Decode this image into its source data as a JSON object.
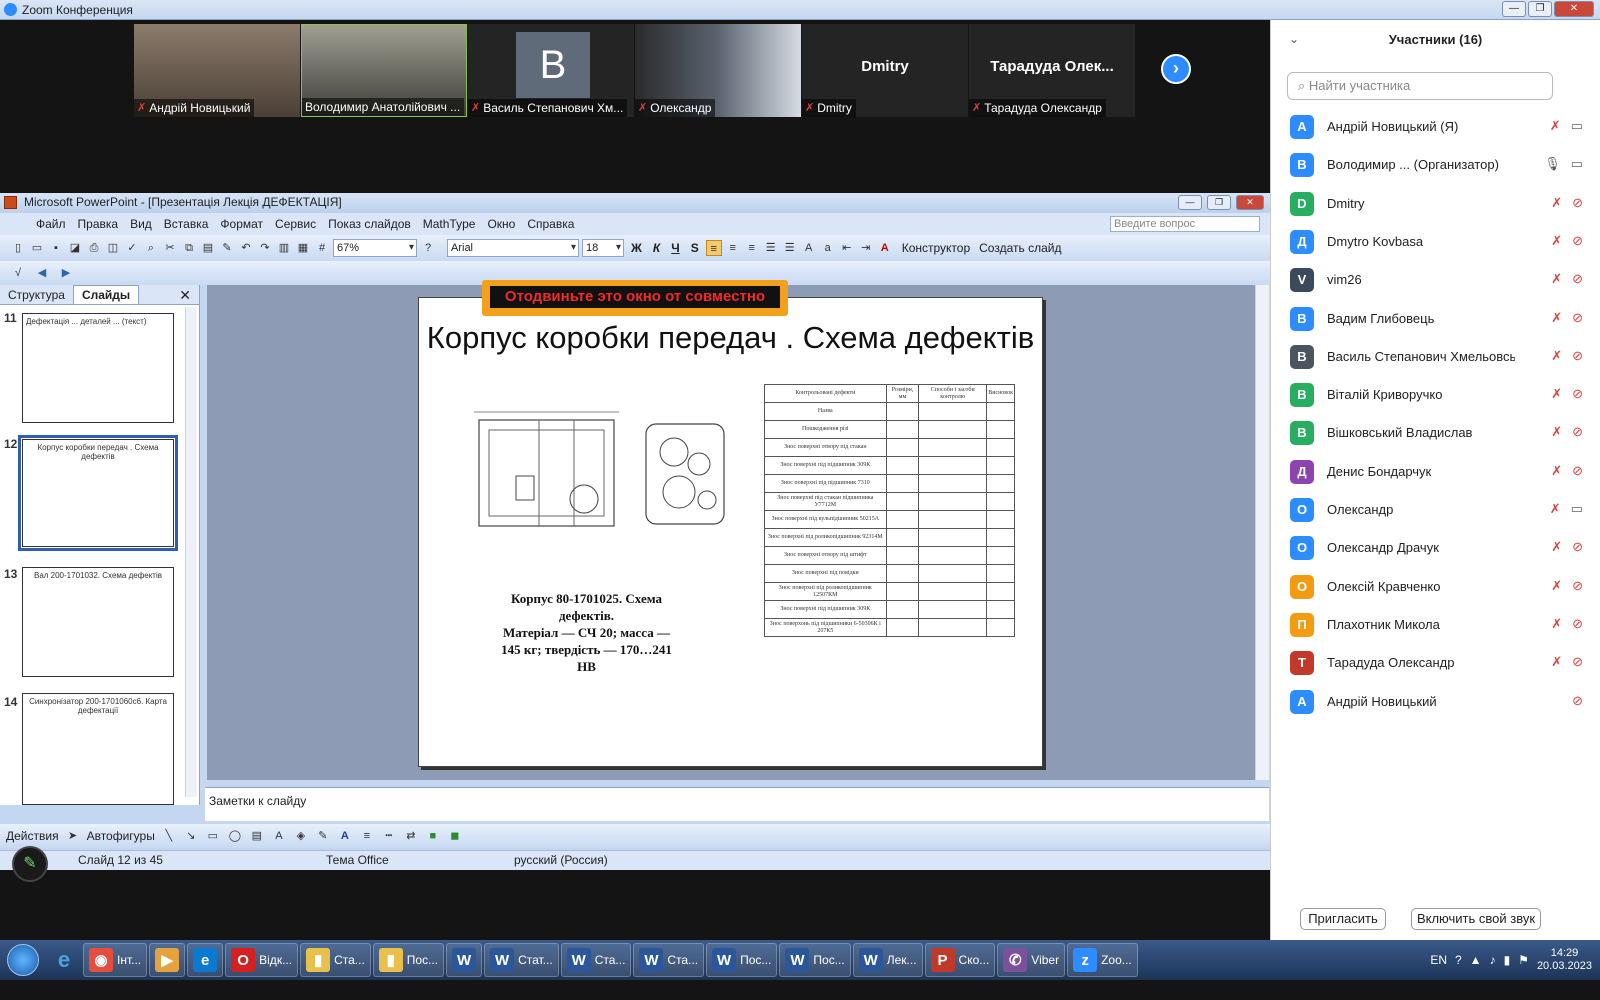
{
  "zoom": {
    "title": "Zoom Конференция"
  },
  "gallery": [
    {
      "name": "Андрій Новицький",
      "muted": true,
      "type": "video",
      "bg": "#6b5a4e"
    },
    {
      "name": "Володимир Анатолійович ...",
      "muted": false,
      "type": "video",
      "bg": "#7a7a70"
    },
    {
      "name": "Василь Степанович Хм...",
      "muted": true,
      "type": "avatar",
      "letter": "B"
    },
    {
      "name": "Олександр",
      "muted": true,
      "type": "video",
      "bg": "#5a6470"
    },
    {
      "name": "Dmitry",
      "muted": true,
      "type": "text",
      "big": "Dmitry"
    },
    {
      "name": "Тарадуда Олександр",
      "muted": true,
      "type": "text",
      "big": "Тарадуда  Олек..."
    }
  ],
  "ppt": {
    "title": "Microsoft PowerPoint - [Презентація  Лекція ДЕФЕКТАЦІЯ]",
    "menu": [
      "Файл",
      "Правка",
      "Вид",
      "Вставка",
      "Формат",
      "Сервис",
      "Показ слайдов",
      "MathType",
      "Окно",
      "Справка"
    ],
    "ask_placeholder": "Введите вопрос",
    "zoom": "67%",
    "font": "Arial",
    "size": "18",
    "fmt_bold": "Ж",
    "fmt_italic": "К",
    "fmt_underline": "Ч",
    "fmt_shadow": "S",
    "designer": "Конструктор",
    "new_slide": "Создать слайд",
    "tab_outline": "Структура",
    "tab_slides": "Слайды",
    "thumbs": [
      {
        "num": "11",
        "text": "Дефектація ... деталей ... (текст)"
      },
      {
        "num": "12",
        "text": "Корпус коробки передач . Схема дефектів"
      },
      {
        "num": "13",
        "text": "Вал 200-1701032. Схема дефектів"
      },
      {
        "num": "14",
        "text": "Синхронізатор 200-1701060с6. Карта дефектації"
      }
    ],
    "share_label": "Отодвиньте это окно от совместно",
    "slide_title": "Корпус коробки передач . Схема дефектів",
    "caption": [
      "Корпус 80-1701025. Схема",
      "дефектів.",
      "Матеріал — СЧ 20; масса —",
      "145 кг; твердість — 170…241",
      "НВ"
    ],
    "table_head": [
      "Контрольовані дефекти",
      "Розміри, мм",
      "Способи і засоби контролю",
      "Висновок"
    ],
    "table_rows": [
      "Назва",
      "1",
      "Пошкодження різі",
      "Знос поверхні отвору під стакан",
      "Знос поверхні під підшипник 309К",
      "Знос поверхні під підшипник 7310",
      "Знос поверхні під стакан підшипника У7712М",
      "Знос поверхні під кульпідшипник 50215А",
      "Знос поверхні під роликопідшипник 92314М",
      "Знос поверхні отвору під штифт",
      "Знос поверхні під повідки",
      "Знос поверхні під роликопідшипник 12507КМ",
      "Знос поверхні під підшипник 309К",
      "Знос поверхонь під підшипники 6-50306К і 207К5"
    ],
    "notes": "Заметки к слайду",
    "actions": "Действия",
    "autoshapes": "Автофигуры",
    "status_slide": "Слайд 12 из 45",
    "status_theme": "Тема Office",
    "status_lang": "русский (Россия)"
  },
  "participants": {
    "header": "Участники (16)",
    "search_placeholder": "Найти участника",
    "list": [
      {
        "letter": "A",
        "color": "#2d8cff",
        "name": "Андрій Новицький (Я)",
        "video": true
      },
      {
        "letter": "B",
        "color": "#2d8cff",
        "name": "Володимир ...  (Организатор)",
        "mic": "on",
        "video": true
      },
      {
        "letter": "D",
        "color": "#27ae60",
        "name": "Dmitry"
      },
      {
        "letter": "Д",
        "color": "#2d8cff",
        "name": "Dmytro Kovbasa"
      },
      {
        "letter": "V",
        "color": "#3a4a5c",
        "name": "vim26"
      },
      {
        "letter": "B",
        "color": "#2d8cff",
        "name": "Вадим Глибовець"
      },
      {
        "letter": "B",
        "color": "#4a5560",
        "name": "Василь Степанович Хмельовсь..."
      },
      {
        "letter": "B",
        "color": "#27ae60",
        "name": "Віталій Криворучко"
      },
      {
        "letter": "B",
        "color": "#27ae60",
        "name": "Вішковський Владислав"
      },
      {
        "letter": "Д",
        "color": "#8e44ad",
        "name": "Денис Бондарчук"
      },
      {
        "letter": "O",
        "color": "#2d8cff",
        "name": "Олександр",
        "video": true
      },
      {
        "letter": "O",
        "color": "#2d8cff",
        "name": "Олександр Драчук"
      },
      {
        "letter": "O",
        "color": "#f39c12",
        "name": "Олексій Кравченко"
      },
      {
        "letter": "П",
        "color": "#f39c12",
        "name": "Плахотник Микола"
      },
      {
        "letter": "T",
        "color": "#c0392b",
        "name": "Тарадуда Олександр"
      },
      {
        "letter": "A",
        "color": "#2d8cff",
        "name": "Андрій Новицький",
        "nomic": true
      }
    ],
    "invite": "Пригласить",
    "unmute": "Включить свой звук"
  },
  "taskbar": {
    "items": [
      {
        "label": "Інт...",
        "color": "#e74c3c",
        "icon": "chrome-icon",
        "glyph": "◉"
      },
      {
        "label": "",
        "color": "#e6a23c",
        "icon": "media-player-icon",
        "glyph": "▶"
      },
      {
        "label": "",
        "color": "#0b79d0",
        "icon": "edge-icon",
        "glyph": "e"
      },
      {
        "label": "Відк...",
        "color": "#d32020",
        "icon": "opera-icon",
        "glyph": "O"
      },
      {
        "label": "Ста...",
        "color": "#e8c04a",
        "icon": "folder-icon",
        "glyph": "▮"
      },
      {
        "label": "Пос...",
        "color": "#e8c04a",
        "icon": "folder-icon",
        "glyph": "▮"
      },
      {
        "label": "",
        "color": "#2b579a",
        "icon": "word-icon",
        "glyph": "W"
      },
      {
        "label": "Стат...",
        "color": "#2b579a",
        "icon": "word-icon",
        "glyph": "W"
      },
      {
        "label": "Ста...",
        "color": "#2b579a",
        "icon": "word-icon",
        "glyph": "W"
      },
      {
        "label": "Ста...",
        "color": "#2b579a",
        "icon": "word-icon",
        "glyph": "W"
      },
      {
        "label": "Пос...",
        "color": "#2b579a",
        "icon": "word-icon",
        "glyph": "W"
      },
      {
        "label": "Пос...",
        "color": "#2b579a",
        "icon": "word-icon",
        "glyph": "W"
      },
      {
        "label": "Лек...",
        "color": "#2b579a",
        "icon": "word-icon",
        "glyph": "W"
      },
      {
        "label": "Ско...",
        "color": "#c0392b",
        "icon": "pdf-icon",
        "glyph": "P"
      },
      {
        "label": "Viber",
        "color": "#7b519d",
        "icon": "viber-icon",
        "glyph": "✆"
      },
      {
        "label": "Zoo...",
        "color": "#2d8cff",
        "icon": "zoom-icon",
        "glyph": "z"
      }
    ],
    "lang": "EN",
    "time": "14:29",
    "date": "20.03.2023"
  }
}
